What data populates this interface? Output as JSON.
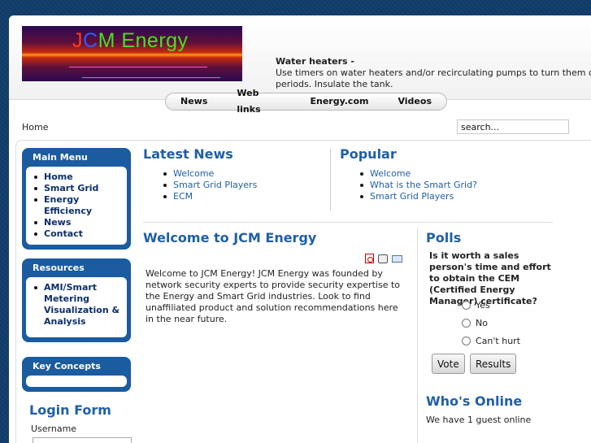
{
  "header": {
    "logo": {
      "text_j": "J",
      "text_c": "C",
      "text_rest": "M Energy"
    },
    "tip": {
      "title": "Water heaters -",
      "line1": "Use timers on water heaters and/or recirculating pumps to turn them off during",
      "line2": "periods. Insulate the tank."
    }
  },
  "nav": {
    "items": [
      "News",
      "Web links",
      "Energy.com",
      "Videos"
    ]
  },
  "breadcrumb": "Home",
  "search": {
    "value": "search..."
  },
  "sidebar": {
    "main_menu": {
      "title": "Main Menu",
      "items": [
        "Home",
        "Smart Grid",
        "Energy Efficiency",
        "News",
        "Contact"
      ]
    },
    "resources": {
      "title": "Resources",
      "items": [
        "AMI/Smart Metering Visualization & Analysis"
      ]
    },
    "key_concepts": {
      "title": "Key Concepts"
    },
    "login": {
      "title": "Login Form",
      "username_label": "Username"
    }
  },
  "latest_news": {
    "title": "Latest News",
    "items": [
      "Welcome",
      "Smart Grid Players",
      "ECM"
    ]
  },
  "popular": {
    "title": "Popular",
    "items": [
      "Welcome",
      "What is the Smart Grid?",
      "Smart Grid Players"
    ]
  },
  "article": {
    "title": "Welcome to JCM Energy",
    "body": "Welcome to JCM Energy! JCM Energy was founded by network security experts to provide security expertise to the Energy and Smart Grid industries. Look to find unaffiliated product and solution recommendations here in the near future."
  },
  "polls": {
    "title": "Polls",
    "question": "Is it worth a sales person's time and effort to obtain the CEM (Certified Energy Manager) certificate?",
    "options": [
      "Yes",
      "No",
      "Can't hurt"
    ],
    "vote_label": "Vote",
    "results_label": "Results"
  },
  "whos_online": {
    "title": "Who's Online",
    "text": "We have 1 guest online"
  },
  "colors": {
    "accent": "#1f5fa8",
    "module_bg": "#1b5ba0",
    "background": "#0f3a66"
  }
}
